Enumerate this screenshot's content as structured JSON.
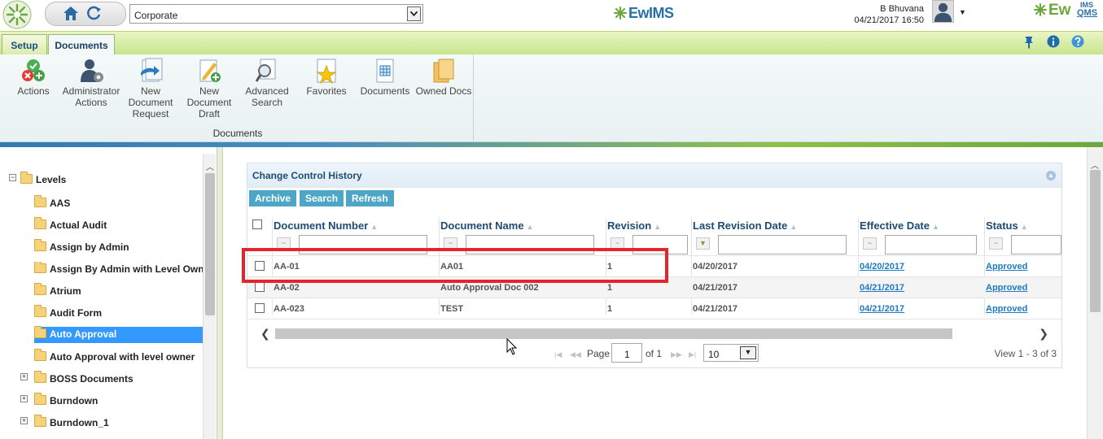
{
  "header": {
    "company_selected": "Corporate",
    "user_name": "B Bhuvana",
    "datetime": "04/21/2017 16:50",
    "center_logo": "EwIMS",
    "right_logo": "Ew",
    "right_logo_top": "IMS",
    "right_logo_bottom": "QMS"
  },
  "ribbon": {
    "tabs": [
      "Setup",
      "Documents"
    ],
    "active_tab": "Documents",
    "group_label": "Documents",
    "buttons": [
      {
        "label": "Actions",
        "icon": "actions-icon"
      },
      {
        "label": "Administrator Actions",
        "icon": "admin-actions-icon"
      },
      {
        "label": "New Document Request",
        "icon": "new-request-icon"
      },
      {
        "label": "New Document Draft",
        "icon": "new-draft-icon"
      },
      {
        "label": "Advanced Search",
        "icon": "search-icon"
      },
      {
        "label": "Favorites",
        "icon": "star-icon"
      },
      {
        "label": "Documents",
        "icon": "documents-icon"
      },
      {
        "label": "Owned Docs",
        "icon": "owned-docs-icon"
      }
    ],
    "right_icons": [
      "pin-icon",
      "info-icon",
      "help-icon"
    ]
  },
  "tree": {
    "root": "Levels",
    "items": [
      {
        "label": "AAS",
        "expandable": false,
        "selected": false
      },
      {
        "label": "Actual Audit",
        "expandable": false,
        "selected": false
      },
      {
        "label": "Assign by Admin",
        "expandable": false,
        "selected": false
      },
      {
        "label": "Assign By Admin with Level Own",
        "expandable": false,
        "selected": false
      },
      {
        "label": "Atrium",
        "expandable": false,
        "selected": false
      },
      {
        "label": "Audit Form",
        "expandable": false,
        "selected": false
      },
      {
        "label": "Auto Approval",
        "expandable": false,
        "selected": true
      },
      {
        "label": "Auto Approval with level owner",
        "expandable": false,
        "selected": false
      },
      {
        "label": "BOSS Documents",
        "expandable": true,
        "selected": false
      },
      {
        "label": "Burndown",
        "expandable": true,
        "selected": false
      },
      {
        "label": "Burndown_1",
        "expandable": true,
        "selected": false
      }
    ]
  },
  "panel": {
    "title": "Change Control History",
    "toolbar": {
      "archive": "Archive",
      "search": "Search",
      "refresh": "Refresh"
    },
    "columns": [
      "Document Number",
      "Document Name",
      "Revision",
      "Last Revision Date",
      "Effective Date",
      "Status"
    ],
    "rows": [
      {
        "number": "AA-01",
        "name": "AA01",
        "revision": "1",
        "last_revision": "04/20/2017",
        "effective": "04/20/2017",
        "status": "Approved"
      },
      {
        "number": "AA-02",
        "name": "Auto Approval Doc 002",
        "revision": "1",
        "last_revision": "04/21/2017",
        "effective": "04/21/2017",
        "status": "Approved"
      },
      {
        "number": "AA-023",
        "name": "TEST",
        "revision": "1",
        "last_revision": "04/21/2017",
        "effective": "04/21/2017",
        "status": "Approved"
      }
    ],
    "pager": {
      "page_label": "Page",
      "page": "1",
      "of_label": "of 1",
      "page_size": "10",
      "view_info": "View 1 - 3 of 3"
    }
  },
  "colors": {
    "ribbon_green": "#c8e58d",
    "tab_text": "#1a4f7a",
    "toolbar_button": "#4ea6c7",
    "selected_tree": "#3399ff",
    "link": "#1e7bc0",
    "highlight": "#e3262c"
  }
}
